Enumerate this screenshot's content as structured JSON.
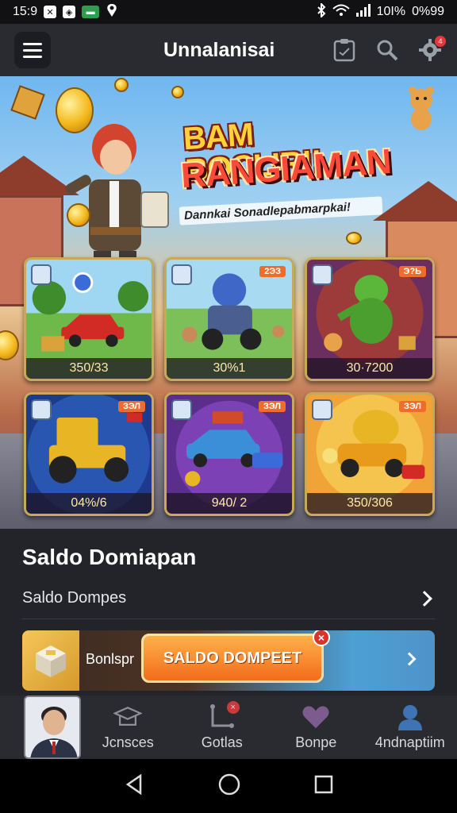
{
  "status_bar": {
    "time": "15:9",
    "battery": "10I%",
    "extra": "0%99",
    "icons": [
      "notification-icon",
      "shield-icon",
      "chat-icon",
      "location-icon",
      "bluetooth-icon",
      "wifi-icon",
      "signal-icon"
    ]
  },
  "app_bar": {
    "title": "Unnalanisai",
    "icons": [
      "menu-icon",
      "clipboard-icon",
      "search-icon",
      "gear-icon"
    ],
    "notification_count": "4"
  },
  "banner": {
    "headline_line1": "BAM BOCLIR!!",
    "headline_line2": "RANGIAMAN",
    "subline": "Dannkai Sonadlepabmarpkai!"
  },
  "games": [
    {
      "price": "350/33",
      "tag": "",
      "theme": "car"
    },
    {
      "price": "30%1",
      "tag": "2ЭЗ",
      "theme": "robot"
    },
    {
      "price": "30·7200",
      "tag": "Э?Ь",
      "theme": "dragon"
    },
    {
      "price": "04%/6",
      "tag": "ЗЭЛ",
      "theme": "tractor"
    },
    {
      "price": "940/ 2",
      "tag": "ЗЭЛ",
      "theme": "racer"
    },
    {
      "price": "350/306",
      "tag": "ЗЭЛ",
      "theme": "tiger"
    }
  ],
  "section": {
    "title": "Saldo Domiapan",
    "row_label": "Saldo Dompes",
    "promo_label": "Bonlspr",
    "promo_button": "SALDO DOMPEET"
  },
  "bottom_nav": {
    "items": [
      {
        "label": "Jcnsces",
        "icon": "graduation-icon"
      },
      {
        "label": "Gotlas",
        "icon": "route-icon"
      },
      {
        "label": "Bonpe",
        "icon": "heart-icon"
      },
      {
        "label": "4ndnaptiim",
        "icon": "profile-icon"
      }
    ]
  },
  "colors": {
    "accent": "#f26c1c",
    "background": "#1f1f24",
    "card_border": "#c7a95a"
  }
}
